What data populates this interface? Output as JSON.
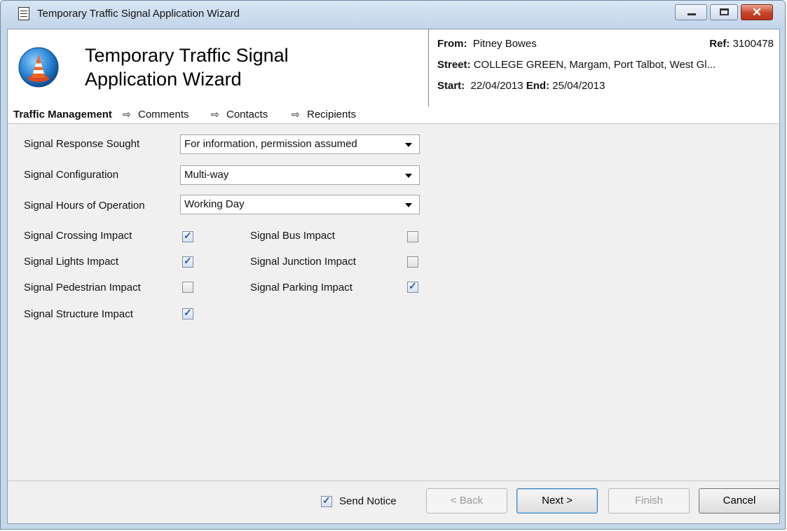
{
  "window": {
    "title": "Temporary Traffic Signal Application Wizard"
  },
  "wizard": {
    "title_line1": "Temporary Traffic Signal",
    "title_line2": "Application Wizard"
  },
  "info": {
    "from_label": "From:",
    "from_value": "Pitney Bowes",
    "ref_label": "Ref:",
    "ref_value": "3100478",
    "street_label": "Street:",
    "street_value": "COLLEGE GREEN, Margam, Port Talbot, West Gl...",
    "start_label": "Start:",
    "start_value": "22/04/2013",
    "end_label": "End:",
    "end_value": "25/04/2013"
  },
  "steps": [
    "Traffic Management",
    "Comments",
    "Contacts",
    "Recipients"
  ],
  "fields": {
    "response": {
      "label": "Signal Response Sought",
      "value": "For information, permission assumed"
    },
    "configuration": {
      "label": "Signal Configuration",
      "value": "Multi-way"
    },
    "hours": {
      "label": "Signal Hours of Operation",
      "value": "Working Day"
    }
  },
  "impacts": {
    "crossing": {
      "label": "Signal Crossing Impact",
      "checked": true
    },
    "bus": {
      "label": "Signal Bus Impact",
      "checked": false
    },
    "lights": {
      "label": "Signal Lights Impact",
      "checked": true
    },
    "junction": {
      "label": "Signal Junction Impact",
      "checked": false
    },
    "pedestrian": {
      "label": "Signal Pedestrian Impact",
      "checked": false
    },
    "parking": {
      "label": "Signal Parking Impact",
      "checked": true
    },
    "structure": {
      "label": "Signal Structure Impact",
      "checked": true
    }
  },
  "footer": {
    "send_notice": {
      "label": "Send Notice",
      "checked": true
    },
    "back": "< Back",
    "next": "Next >",
    "finish": "Finish",
    "cancel": "Cancel"
  },
  "icons": {
    "app": "document-icon",
    "logo": "traffic-cone-icon",
    "tick": "✓",
    "step_arrow": "⇨"
  }
}
